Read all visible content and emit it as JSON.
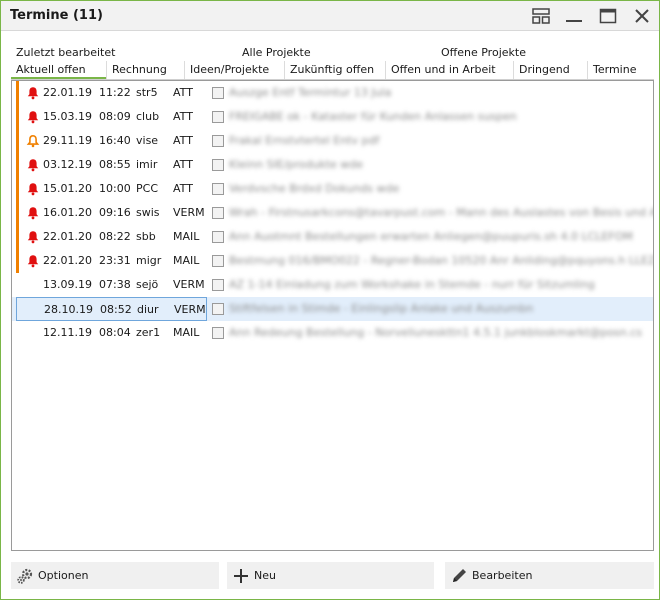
{
  "window": {
    "title": "Termine (11)"
  },
  "tabs_row1": [
    {
      "label": "Zuletzt bearbeitet"
    },
    {
      "label": "Alle Projekte"
    },
    {
      "label": "Offene Projekte"
    }
  ],
  "tabs_row2": [
    {
      "label": "Aktuell offen",
      "active": true
    },
    {
      "label": "Rechnung"
    },
    {
      "label": "Ideen/Projekte"
    },
    {
      "label": "Zukünftig offen"
    },
    {
      "label": "Offen und in Arbeit"
    },
    {
      "label": "Dringend"
    },
    {
      "label": "Termine"
    }
  ],
  "colors": {
    "accent": "#7ab648",
    "flag": "#f08000",
    "bell_red": "#e01010",
    "bell_orange": "#f08000"
  },
  "rows": [
    {
      "date": "22.01.19",
      "time": "11:22",
      "user": "str5",
      "type": "ATT",
      "bell": "bell-red-icon",
      "flag": true,
      "selected": false,
      "subject": "Auszge Entf Termintur 13 Jula"
    },
    {
      "date": "15.03.19",
      "time": "08:09",
      "user": "club",
      "type": "ATT",
      "bell": "bell-red-icon",
      "flag": true,
      "selected": false,
      "subject": "FREIGABE ok - Kataster für Kunden Anlassen suspen"
    },
    {
      "date": "29.11.19",
      "time": "16:40",
      "user": "vise",
      "type": "ATT",
      "bell": "bell-orange-icon",
      "flag": true,
      "selected": false,
      "subject": "Frakal Ernstvtertel Entv pdf"
    },
    {
      "date": "03.12.19",
      "time": "08:55",
      "user": "imir",
      "type": "ATT",
      "bell": "bell-red-icon",
      "flag": true,
      "selected": false,
      "subject": "Kleinn SIE/produkte wde"
    },
    {
      "date": "15.01.20",
      "time": "10:00",
      "user": "PCC",
      "type": "ATT",
      "bell": "bell-red-icon",
      "flag": true,
      "selected": false,
      "subject": "Verdvsche Brdxd Dokunds wde"
    },
    {
      "date": "16.01.20",
      "time": "09:16",
      "user": "swis",
      "type": "VERM",
      "bell": "bell-red-icon",
      "flag": true,
      "selected": false,
      "subject": "Wrah - Firstnusarkcons@tavarpust.com - Mann des Auslastes von Besis und Arta"
    },
    {
      "date": "22.01.20",
      "time": "08:22",
      "user": "sbb",
      "type": "MAIL",
      "bell": "bell-red-icon",
      "flag": true,
      "selected": false,
      "subject": "Ann Auotmnt Bestellungen erwarten Anliegen@puupuris.sh 4.0 LCLEFOM"
    },
    {
      "date": "22.01.20",
      "time": "23:31",
      "user": "migr",
      "type": "MAIL",
      "bell": "bell-red-icon",
      "flag": true,
      "selected": false,
      "subject": "Bestmung 016/BMO022 - Regner-Bodan 10520 Anr Anliding@pquyons.h LLEZ"
    },
    {
      "date": "13.09.19",
      "time": "07:38",
      "user": "sejö",
      "type": "VERM",
      "bell": "",
      "flag": false,
      "selected": false,
      "subject": "AZ 1-14 Einladung zum Workshake in Stemde - nurr für Sitzumling"
    },
    {
      "date": "28.10.19",
      "time": "08:52",
      "user": "diur",
      "type": "VERM",
      "bell": "",
      "flag": false,
      "selected": true,
      "subject": "Stiftfelsen in Stimde - Einlingslip Anlake und Auszumbn"
    },
    {
      "date": "12.11.19",
      "time": "08:04",
      "user": "zer1",
      "type": "MAIL",
      "bell": "",
      "flag": false,
      "selected": false,
      "subject": "Ann Redeung Bestellung - Norveliuneskttn1 4.5.1 junkbloskmarkt@posn.cs"
    }
  ],
  "buttons": {
    "options": {
      "label": "Optionen",
      "icon": "gear-icon"
    },
    "new": {
      "label": "Neu",
      "icon": "plus-icon"
    },
    "edit": {
      "label": "Bearbeiten",
      "icon": "pencil-icon"
    }
  }
}
